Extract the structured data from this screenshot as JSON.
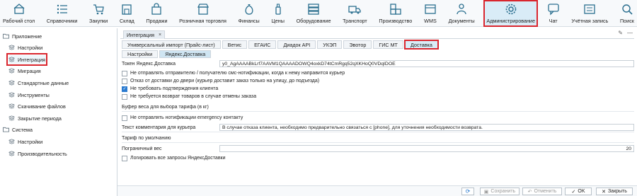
{
  "toolbar": {
    "items": [
      {
        "label": "Рабочий стол",
        "icon": "home-icon"
      },
      {
        "label": "Справочники",
        "icon": "list-icon"
      },
      {
        "label": "Закупки",
        "icon": "cart-icon"
      },
      {
        "label": "Склад",
        "icon": "warehouse-icon"
      },
      {
        "label": "Продажи",
        "icon": "shopping-bag-icon"
      },
      {
        "label": "Розничная торговля",
        "icon": "shop-icon"
      },
      {
        "label": "Финансы",
        "icon": "money-bag-icon"
      },
      {
        "label": "Цены",
        "icon": "bottle-icon"
      },
      {
        "label": "Оборудование",
        "icon": "server-icon"
      },
      {
        "label": "Транспорт",
        "icon": "truck-icon"
      },
      {
        "label": "Производство",
        "icon": "factory-icon"
      },
      {
        "label": "WMS",
        "icon": "wms-icon"
      },
      {
        "label": "Документы",
        "icon": "person-doc-icon"
      },
      {
        "label": "Администрирование",
        "icon": "gear-icon"
      },
      {
        "label": "Чат",
        "icon": "chat-icon"
      },
      {
        "label": "Учётная запись",
        "icon": "account-icon"
      },
      {
        "label": "Поиск",
        "icon": "search-icon"
      }
    ],
    "active": "Администрирование"
  },
  "sidebar": {
    "items": [
      {
        "label": "Приложение",
        "level": 0
      },
      {
        "label": "Настройки",
        "level": 1
      },
      {
        "label": "Интеграция",
        "level": 1,
        "selected": true
      },
      {
        "label": "Миграция",
        "level": 1
      },
      {
        "label": "Стандартные данные",
        "level": 1
      },
      {
        "label": "Инструменты",
        "level": 1
      },
      {
        "label": "Скачивание файлов",
        "level": 1
      },
      {
        "label": "Закрытие периода",
        "level": 1
      },
      {
        "label": "Система",
        "level": 0
      },
      {
        "label": "Настройки",
        "level": 1
      },
      {
        "label": "Производительность",
        "level": 1
      }
    ]
  },
  "doc_tab": {
    "label": "Интеграция",
    "close": "×"
  },
  "corner": {
    "edit": "✎",
    "minimize": "—"
  },
  "tabs": [
    "Универсальный импорт (Прайс-лист)",
    "Ветис",
    "ЕГАИС",
    "Диадок API",
    "УКЭП",
    "Эвотор",
    "ГИС МТ",
    "Доставка"
  ],
  "active_tab": "Доставка",
  "subtabs": [
    "Настройки",
    "Яндекс.Доставка"
  ],
  "active_subtab": "Яндекс.Доставка",
  "form": {
    "token_label": "Токен Яндекс.Доставка",
    "token_value": "y0_AgAAAABkLrf7AAVM1QAAAADOWQ4oxkD74tCmRgq52qXKHoQ0VDqIDOE",
    "chk1": "Не отправлять отправителю / получателю смс-нотификации, когда к нему направится курьер",
    "chk2": "Отказ от доставки до двери (курьер доставит заказ только на улицу, до подъезда)",
    "chk3": "Не требовать подтверждения клиента",
    "chk4": "Не требуется возврат товаров в случае отмены заказа",
    "buffer_label": "Буфер веса для выбора тарифа (в кг)",
    "chk5": "Не отправлять нотификации emergency контакту",
    "comment_label": "Текст комментария для курьера",
    "comment_value": "В случае отказа клиента, необходимо предварительно связаться с [phone], для уточнения необходимости возврата.",
    "tariff_label": "Тариф по умолчанию",
    "weight_label": "Пограничный вес",
    "weight_value": "20",
    "chk6": "Логировать все запросы ЯндексДоставки"
  },
  "buttons": {
    "refresh": "⟳",
    "save": "Сохранить",
    "cancel": "Отменить",
    "ok": "OK",
    "close": "Закрыть"
  },
  "colors": {
    "accent": "#d9262e",
    "selected_bg": "#d9ecf7",
    "checkbox": "#2b7bd0"
  }
}
